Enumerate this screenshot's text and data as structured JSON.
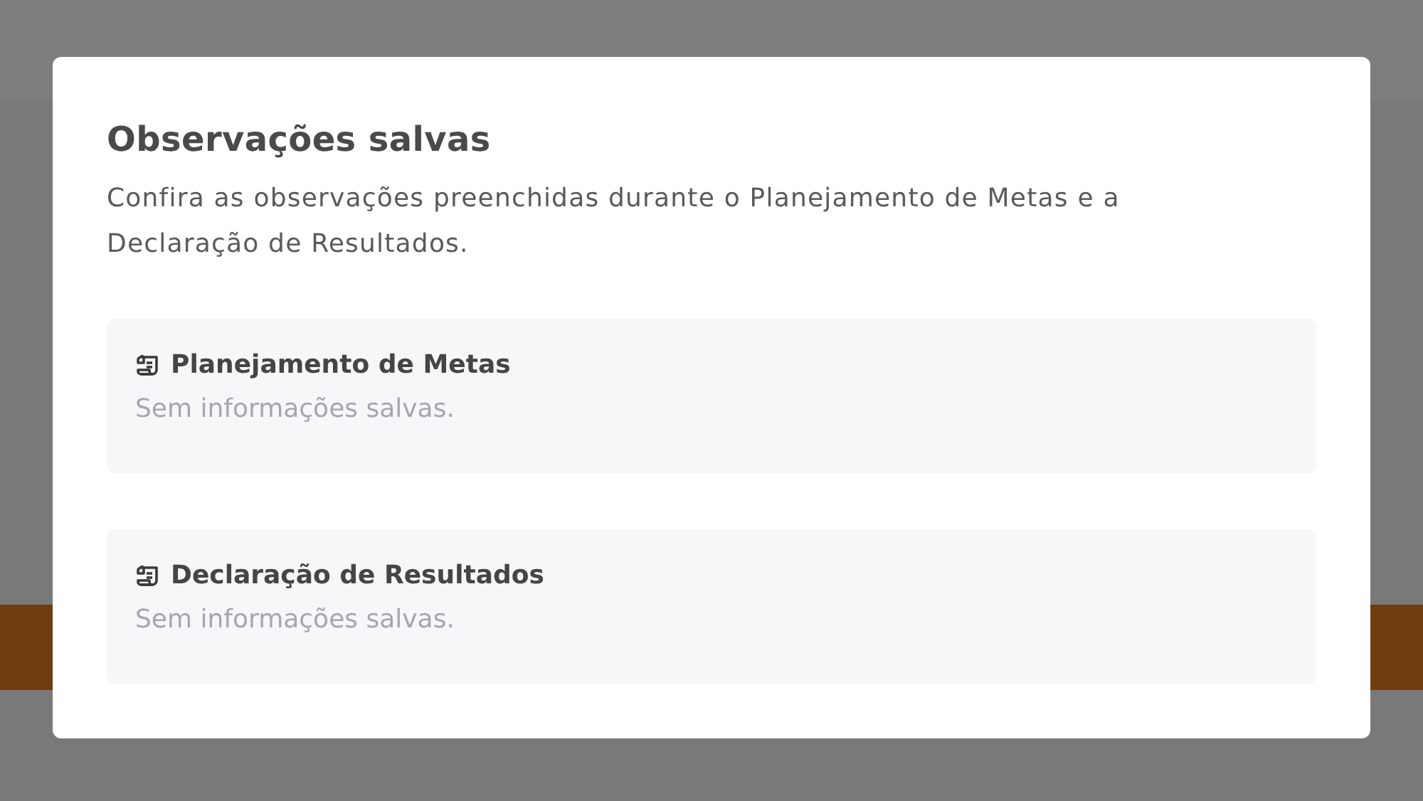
{
  "dialog": {
    "title": "Observações salvas",
    "description": "Confira as observações preenchidas durante o Planejamento de Metas e a Declaração de Resultados.",
    "sections": [
      {
        "title": "Planejamento de Metas",
        "placeholder": "Sem informações salvas."
      },
      {
        "title": "Declaração de Resultados",
        "placeholder": "Sem informações salvas."
      }
    ]
  }
}
